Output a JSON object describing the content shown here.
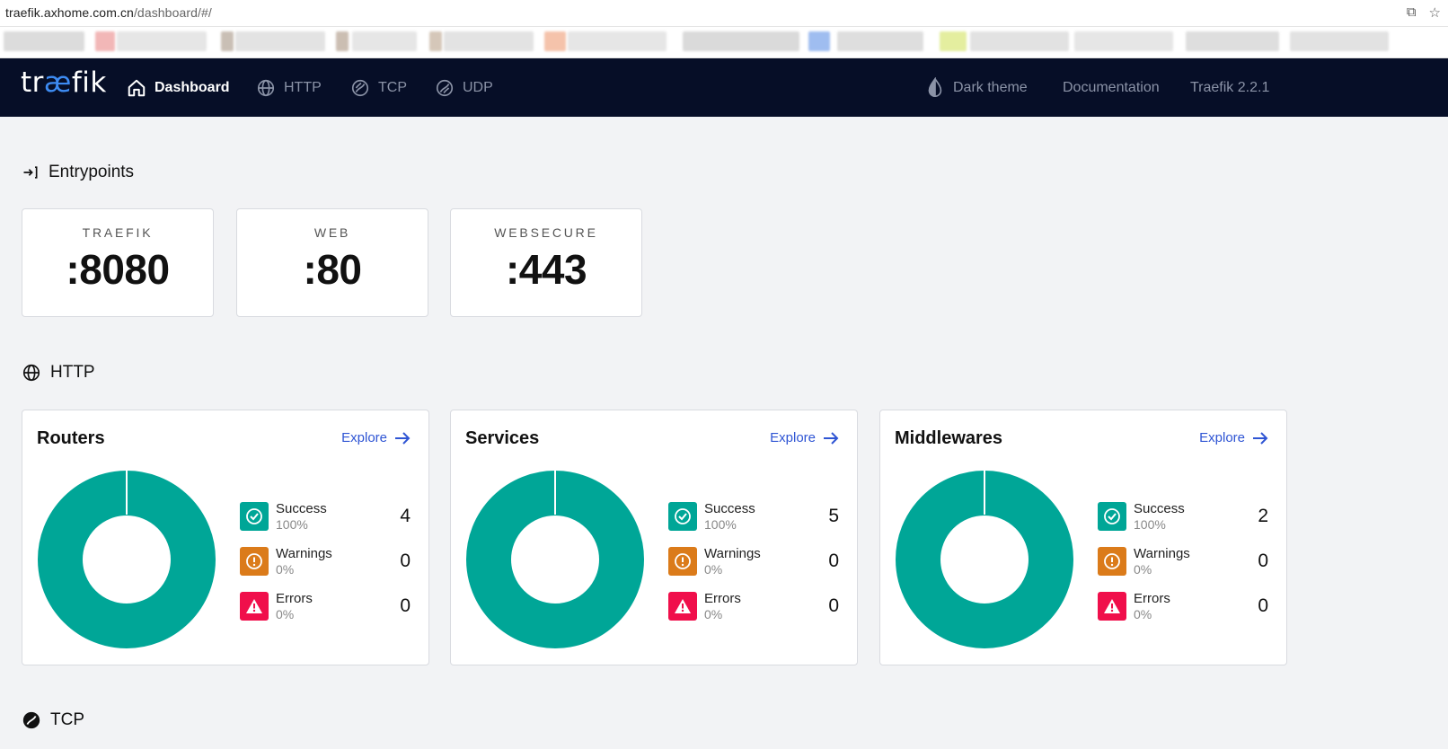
{
  "browser": {
    "url_host": "traefik.axhome.com.cn",
    "url_path": "/dashboard/#/"
  },
  "nav": {
    "logo_prefix": "tr",
    "logo_ae": "æ",
    "logo_suffix": "fik",
    "items": [
      {
        "label": "Dashboard",
        "icon": "home-icon"
      },
      {
        "label": "HTTP",
        "icon": "globe-icon"
      },
      {
        "label": "TCP",
        "icon": "tcp-icon"
      },
      {
        "label": "UDP",
        "icon": "udp-icon"
      }
    ],
    "right": {
      "theme_label": "Dark theme",
      "docs_label": "Documentation",
      "version_label": "Traefik 2.2.1"
    }
  },
  "entrypoints": {
    "title": "Entrypoints",
    "items": [
      {
        "name": "TRAEFIK",
        "port": ":8080"
      },
      {
        "name": "WEB",
        "port": ":80"
      },
      {
        "name": "WEBSECURE",
        "port": ":443"
      }
    ]
  },
  "http": {
    "title": "HTTP",
    "cards": [
      {
        "title": "Routers",
        "explore": "Explore",
        "stats": [
          {
            "label": "Success",
            "pct": "100%",
            "count": "4"
          },
          {
            "label": "Warnings",
            "pct": "0%",
            "count": "0"
          },
          {
            "label": "Errors",
            "pct": "0%",
            "count": "0"
          }
        ]
      },
      {
        "title": "Services",
        "explore": "Explore",
        "stats": [
          {
            "label": "Success",
            "pct": "100%",
            "count": "5"
          },
          {
            "label": "Warnings",
            "pct": "0%",
            "count": "0"
          },
          {
            "label": "Errors",
            "pct": "0%",
            "count": "0"
          }
        ]
      },
      {
        "title": "Middlewares",
        "explore": "Explore",
        "stats": [
          {
            "label": "Success",
            "pct": "100%",
            "count": "2"
          },
          {
            "label": "Warnings",
            "pct": "0%",
            "count": "0"
          },
          {
            "label": "Errors",
            "pct": "0%",
            "count": "0"
          }
        ]
      }
    ]
  },
  "tcp": {
    "title": "TCP"
  },
  "colors": {
    "success": "#00a697",
    "warning": "#db7b1a",
    "error": "#f00f4b",
    "nav_bg": "#060e27",
    "link": "#2f55d4"
  }
}
